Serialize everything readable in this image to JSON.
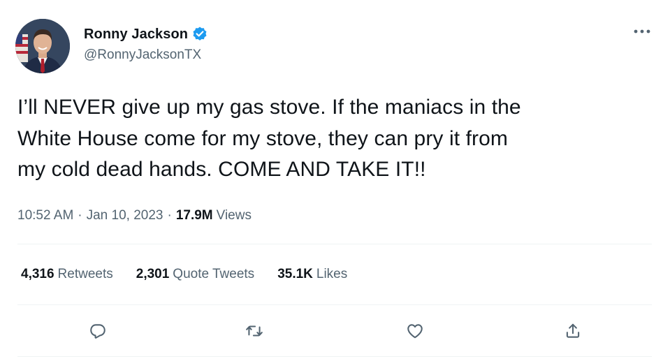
{
  "author": {
    "display_name": "Ronny Jackson",
    "handle": "@RonnyJacksonTX",
    "verified": true,
    "avatar_icon": "profile-photo"
  },
  "tweet": {
    "text": "I’ll NEVER give up my gas stove. If the maniacs in the\nWhite House come for my stove, they can pry it from\nmy cold dead hands. COME AND TAKE IT!!"
  },
  "meta": {
    "time": "10:52 AM",
    "separator": "·",
    "date": "Jan 10, 2023",
    "views_count": "17.9M",
    "views_label": "Views"
  },
  "stats": {
    "retweets_count": "4,316",
    "retweets_label": "Retweets",
    "quotes_count": "2,301",
    "quotes_label": "Quote Tweets",
    "likes_count": "35.1K",
    "likes_label": "Likes"
  },
  "actions": [
    "reply-icon",
    "retweet-icon",
    "like-icon",
    "share-icon"
  ],
  "colors": {
    "text_primary": "#0f1419",
    "text_secondary": "#536471",
    "verified_blue": "#1d9bf0",
    "divider": "#eff3f4"
  }
}
